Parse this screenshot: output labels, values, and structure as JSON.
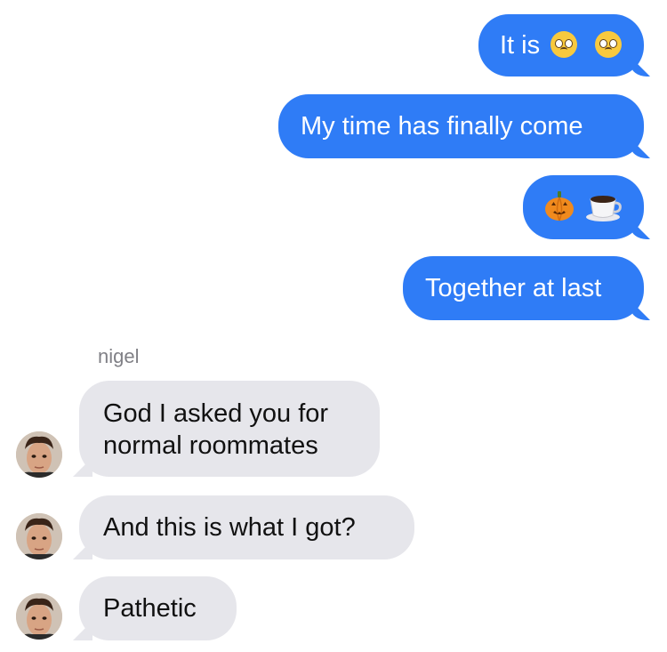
{
  "thread": {
    "sent_messages": [
      {
        "text": "It is",
        "emoji": [
          "pleading-face-emoji",
          "pleading-face-emoji"
        ]
      },
      {
        "text": "My time has finally come"
      },
      {
        "text": "",
        "emoji": [
          "jack-o-lantern-emoji",
          "hot-beverage-emoji"
        ]
      },
      {
        "text": "Together at last"
      }
    ],
    "sender_name": "nigel",
    "received_messages": [
      {
        "line1": "God I asked you for",
        "line2": "normal roommates"
      },
      {
        "text": "And this is what I got?"
      },
      {
        "text": "Pathetic"
      }
    ]
  },
  "colors": {
    "sent_bubble": "#2f7cf6",
    "received_bubble": "#e6e6eb",
    "sender_label": "#808086"
  }
}
